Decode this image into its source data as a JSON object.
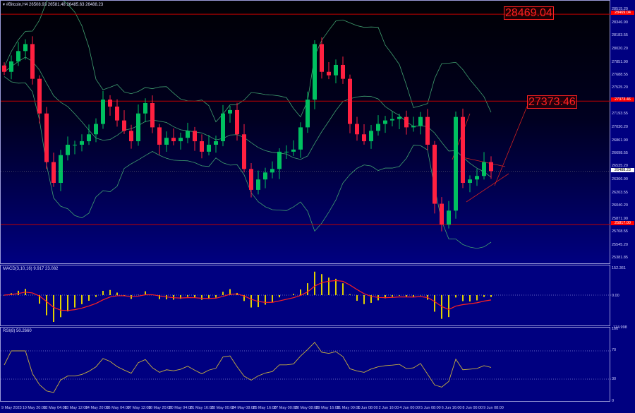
{
  "header": {
    "symbol": "#Bitcoin,H4",
    "ohlc": "26508.93 26581.48 26485.63 26488.23"
  },
  "price_axis": [
    "28515.20",
    "28346.90",
    "28183.55",
    "28020.20",
    "27851.90",
    "27688.55",
    "27525.20",
    "27193.55",
    "27030.20",
    "26861.90",
    "26698.55",
    "26535.20",
    "26366.90",
    "26203.55",
    "26040.20",
    "25871.90",
    "25708.55",
    "25545.20",
    "25381.85"
  ],
  "current_price": "26488.23",
  "levels": [
    {
      "price": 28469.04,
      "label": "28469.04",
      "tag": "28469.04"
    },
    {
      "price": 27373.46,
      "label": "27373.46",
      "tag": "27373.46"
    },
    {
      "price": 25817.0,
      "tag": "25817.00"
    }
  ],
  "macd": {
    "label": "MACD(3,10,16) 9.917 23.082",
    "axis": [
      "152.361",
      "0.00",
      "-174.998"
    ]
  },
  "rsi": {
    "label": "RSI(8) 50.2660",
    "axis": [
      "100",
      "70",
      "30",
      "0"
    ]
  },
  "time_axis": [
    "9 May 2023",
    "10 May 20:00",
    "12 May 04:00",
    "13 May 12:00",
    "14 May 20:00",
    "16 May 04:00",
    "17 May 12:00",
    "18 May 20:00",
    "20 May 04:00",
    "21 May 16:00",
    "23 May 00:00",
    "24 May 08:00",
    "25 May 16:00",
    "27 May 00:00",
    "28 May 08:00",
    "29 May 16:00",
    "31 May 00:00",
    "1 Jun 08:00",
    "2 Jun 16:00",
    "4 Jun 00:00",
    "5 Jun 08:00",
    "6 Jun 16:00",
    "8 Jun 00:00",
    "9 Jun 08:00"
  ],
  "colors": {
    "bull": "#00c060",
    "bear": "#ff2040",
    "band": "#40a070",
    "macd_hist": "#e0d000",
    "signal": "#ff2020",
    "rsi": "#c8b040",
    "level": "#c00000"
  },
  "chart_data": {
    "type": "candlestick",
    "title": "#Bitcoin,H4",
    "ylim": [
      25381.85,
      28515.2
    ],
    "closes": [
      27743,
      27874,
      28005,
      28093,
      27655,
      27218,
      26605,
      26343,
      26693,
      26824,
      26824,
      26868,
      26955,
      27086,
      27393,
      27305,
      27130,
      26999,
      26868,
      27218,
      27349,
      27043,
      26824,
      26911,
      26868,
      26911,
      26999,
      26868,
      26736,
      26824,
      26868,
      27218,
      27261,
      26955,
      26518,
      26255,
      26386,
      26474,
      26518,
      26736,
      26736,
      26763,
      27043,
      27393,
      28093,
      27743,
      27699,
      27830,
      27655,
      27086,
      26955,
      26868,
      26999,
      27086,
      27130,
      27148,
      27174,
      27043,
      27061,
      27174,
      26824,
      26080,
      25817,
      25993,
      27174,
      26343,
      26386,
      26430,
      26605,
      26491
    ]
  }
}
